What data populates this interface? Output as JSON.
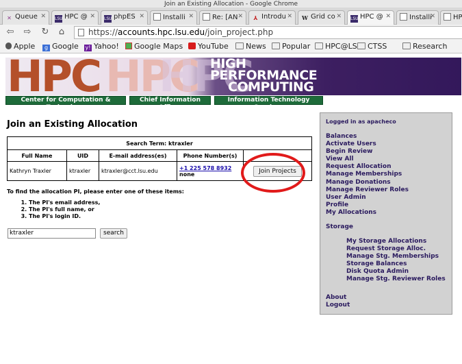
{
  "window": {
    "title": "Join an Existing Allocation - Google Chrome"
  },
  "tabs": [
    {
      "label": "Queue",
      "icon": "queue-icon"
    },
    {
      "label": "HPC @",
      "icon": "lsu-icon"
    },
    {
      "label": "phpES",
      "icon": "lsu-icon"
    },
    {
      "label": "Installi",
      "icon": "page-icon"
    },
    {
      "label": "Re: [AN",
      "icon": "page-icon"
    },
    {
      "label": "Introdu",
      "icon": "pdf-icon"
    },
    {
      "label": "Grid co",
      "icon": "wikipedia-icon"
    },
    {
      "label": "HPC @",
      "icon": "lsu-icon",
      "active": true
    },
    {
      "label": "Installi",
      "icon": "page-icon"
    },
    {
      "label": "HPC @",
      "icon": "page-icon"
    }
  ],
  "toolbar": {
    "url_scheme": "https://",
    "url_host": "accounts.hpc.lsu.edu",
    "url_path": "/join_project.php"
  },
  "bookmarks": [
    {
      "label": "Apple",
      "icon": "apple-icon"
    },
    {
      "label": "Google",
      "icon": "google-icon"
    },
    {
      "label": "Yahoo!",
      "icon": "yahoo-icon"
    },
    {
      "label": "Google Maps",
      "icon": "maps-icon"
    },
    {
      "label": "YouTube",
      "icon": "youtube-icon"
    },
    {
      "label": "News",
      "icon": "folder-icon"
    },
    {
      "label": "Popular",
      "icon": "folder-icon"
    },
    {
      "label": "HPC@LSU",
      "icon": "folder-icon"
    },
    {
      "label": "CTSS",
      "icon": "folder-icon"
    },
    {
      "label": "Research",
      "icon": "folder-icon"
    }
  ],
  "banner": {
    "logo_text": "HPC",
    "line1": "HIGH",
    "line2": "PERFORMANCE",
    "line3": "COMPUTING"
  },
  "unit_links": [
    "Center for Computation & Technology",
    "Chief Information Officer",
    "Information Technology Services"
  ],
  "main": {
    "title": "Join an Existing Allocation",
    "search_term_label": "Search Term: ktraxler",
    "columns": [
      "Full Name",
      "UID",
      "E-mail address(es)",
      "Phone Number(s)"
    ],
    "rows": [
      {
        "full_name": "Kathryn Traxler",
        "uid": "ktraxler",
        "email": "ktraxler@cct.lsu.edu",
        "phone": "+1 225 578 8932",
        "phone2": "none",
        "action": "Join Projects"
      }
    ],
    "instructions": "To find the allocation PI, please enter one of these items:",
    "items": [
      "The PI's email address,",
      "The PI's full name, or",
      "The PI's login ID."
    ],
    "search_value": "ktraxler",
    "search_button": "search"
  },
  "sidebar": {
    "logged_in": "Logged in as apacheco",
    "links": [
      "Balances",
      "Activate Users",
      "Begin Review",
      "View All",
      "Request Allocation",
      "Manage Memberships",
      "Manage Donations",
      "Manage Reviewer Roles",
      "User Admin",
      "Profile",
      "My Allocations"
    ],
    "storage_heading": "Storage",
    "storage_links": [
      "My Storage Allocations",
      "Request Storage Alloc.",
      "Manage Stg. Memberships",
      "Storage Balances",
      "Disk Quota Admin",
      "Manage Stg. Reviewer Roles"
    ],
    "bottom_links": [
      "About",
      "Logout"
    ]
  }
}
